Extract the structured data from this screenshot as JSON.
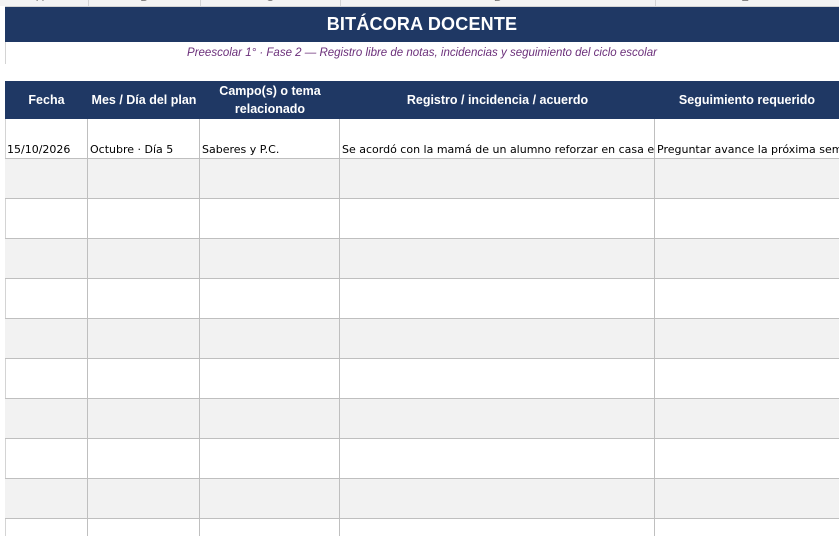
{
  "sheet": {
    "column_letters": [
      "A",
      "B",
      "C",
      "D",
      "E"
    ],
    "title": "BITÁCORA DOCENTE",
    "subtitle": "Preescolar 1° · Fase 2 — Registro libre de notas, incidencias y seguimiento del ciclo escolar",
    "headers": {
      "fecha": "Fecha",
      "mes_dia": "Mes / Día del plan",
      "campo_line1": "Campo(s) o tema",
      "campo_line2": "relacionado",
      "registro": "Registro / incidencia / acuerdo",
      "seguimiento": "Seguimiento requerido"
    },
    "rows": [
      {
        "fecha": "15/10/2026",
        "mes_dia": "Octubre · Día 5",
        "campo": "Saberes y P.C.",
        "registro": "Se acordó con la mamá de un alumno reforzar en casa el",
        "seguimiento": "Preguntar avance la próxima sem"
      }
    ],
    "empty_rows": 10
  },
  "colors": {
    "header_bg": "#1f3864",
    "header_text": "#ffffff",
    "subtitle_text": "#6b2f7a",
    "alt_row_bg": "#f2f2f2",
    "grid_line": "#bfbfbf"
  }
}
